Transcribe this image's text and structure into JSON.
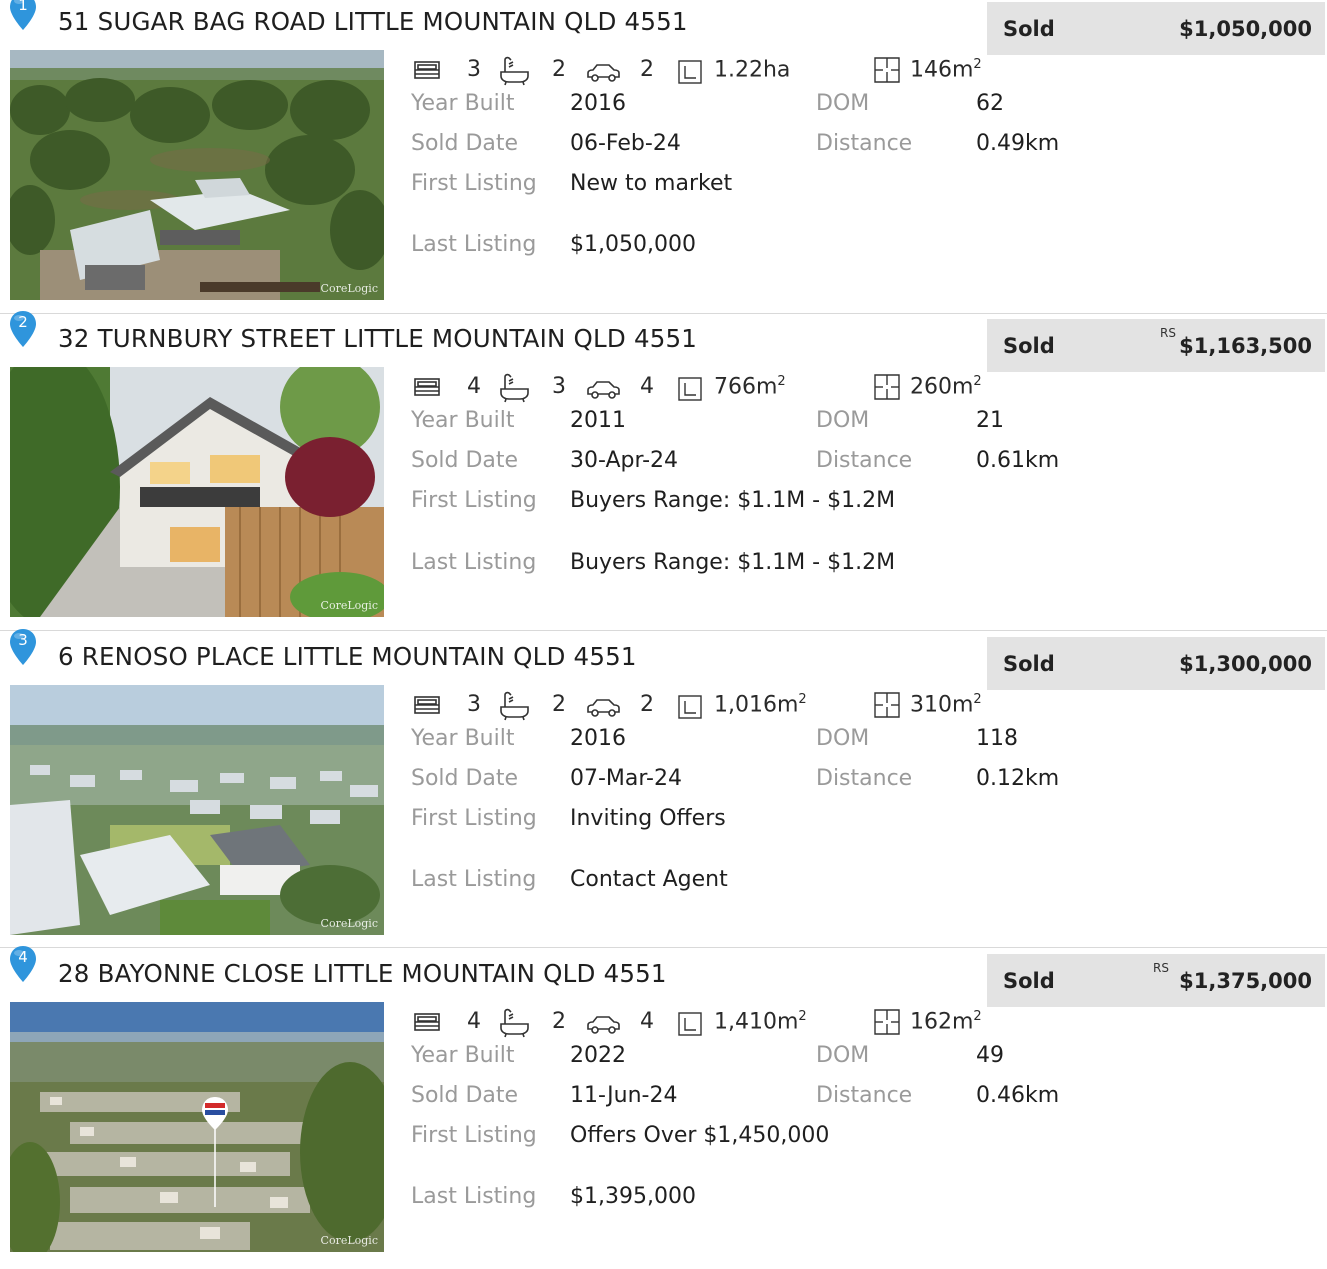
{
  "labels": {
    "year_built": "Year Built",
    "sold_date": "Sold Date",
    "first_listing": "First Listing",
    "last_listing": "Last Listing",
    "dom": "DOM",
    "distance": "Distance",
    "sold": "Sold",
    "watermark": "CoreLogic"
  },
  "icons": [
    "map-pin-icon",
    "bed-icon",
    "bath-icon",
    "car-icon",
    "land-size-icon",
    "floor-plan-icon"
  ],
  "colors": {
    "pin": "#2f95dc",
    "sold_box": "#e3e3e3",
    "label": "#9a9a9a"
  },
  "listings": [
    {
      "index": "1",
      "address": "51 SUGAR BAG ROAD LITTLE MOUNTAIN QLD 4551",
      "status": "Sold",
      "price_tag": "",
      "price": "$1,050,000",
      "beds": "3",
      "baths": "2",
      "cars": "2",
      "land": "1.22ha",
      "land_unit": "",
      "floor": "146m",
      "floor_unit": "2",
      "year_built": "2016",
      "sold_date": "06-Feb-24",
      "dom": "62",
      "distance": "0.49km",
      "first_listing": "New to market",
      "last_listing": "$1,050,000"
    },
    {
      "index": "2",
      "address": "32 TURNBURY STREET LITTLE MOUNTAIN QLD 4551",
      "status": "Sold",
      "price_tag": "RS",
      "price": "$1,163,500",
      "beds": "4",
      "baths": "3",
      "cars": "4",
      "land": "766m",
      "land_unit": "2",
      "floor": "260m",
      "floor_unit": "2",
      "year_built": "2011",
      "sold_date": "30-Apr-24",
      "dom": "21",
      "distance": "0.61km",
      "first_listing": "Buyers Range: $1.1M - $1.2M",
      "last_listing": "Buyers Range: $1.1M - $1.2M"
    },
    {
      "index": "3",
      "address": "6 RENOSO PLACE LITTLE MOUNTAIN QLD 4551",
      "status": "Sold",
      "price_tag": "",
      "price": "$1,300,000",
      "beds": "3",
      "baths": "2",
      "cars": "2",
      "land": "1,016m",
      "land_unit": "2",
      "floor": "310m",
      "floor_unit": "2",
      "year_built": "2016",
      "sold_date": "07-Mar-24",
      "dom": "118",
      "distance": "0.12km",
      "first_listing": "Inviting Offers",
      "last_listing": "Contact Agent"
    },
    {
      "index": "4",
      "address": "28 BAYONNE CLOSE LITTLE MOUNTAIN QLD 4551",
      "status": "Sold",
      "price_tag": "RS",
      "price": "$1,375,000",
      "beds": "4",
      "baths": "2",
      "cars": "4",
      "land": "1,410m",
      "land_unit": "2",
      "floor": "162m",
      "floor_unit": "2",
      "year_built": "2022",
      "sold_date": "11-Jun-24",
      "dom": "49",
      "distance": "0.46km",
      "first_listing": "Offers Over $1,450,000",
      "last_listing": "$1,395,000"
    }
  ]
}
